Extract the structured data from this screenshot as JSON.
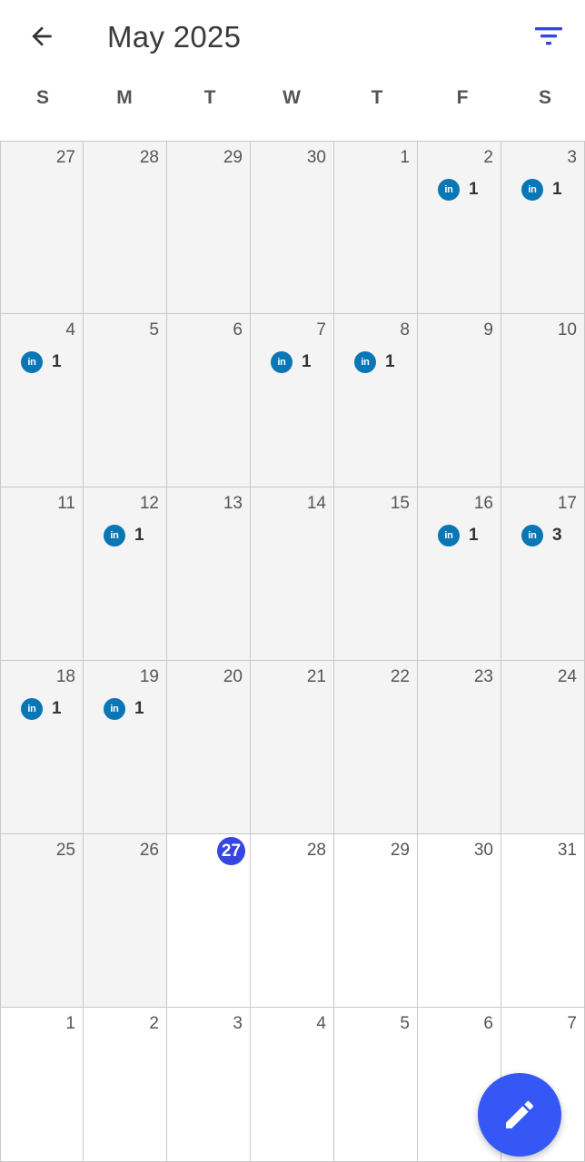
{
  "header": {
    "title": "May 2025",
    "back_icon": "arrow-left-icon",
    "filter_icon": "filter-icon"
  },
  "colors": {
    "accent": "#3547e0",
    "linkedin": "#0a76b4",
    "fab": "#3557f6",
    "past_cell": "#f4f4f4",
    "future_cell": "#ffffff"
  },
  "weekdays": [
    "S",
    "M",
    "T",
    "W",
    "T",
    "F",
    "S"
  ],
  "today": "27",
  "weeks": [
    [
      {
        "day": "27",
        "current": false,
        "events": []
      },
      {
        "day": "28",
        "current": false,
        "events": []
      },
      {
        "day": "29",
        "current": false,
        "events": []
      },
      {
        "day": "30",
        "current": false,
        "events": []
      },
      {
        "day": "1",
        "current": false,
        "events": []
      },
      {
        "day": "2",
        "current": false,
        "events": [
          {
            "icon": "linkedin-icon",
            "label": "in",
            "count": "1"
          }
        ]
      },
      {
        "day": "3",
        "current": false,
        "events": [
          {
            "icon": "linkedin-icon",
            "label": "in",
            "count": "1"
          }
        ]
      }
    ],
    [
      {
        "day": "4",
        "current": false,
        "events": [
          {
            "icon": "linkedin-icon",
            "label": "in",
            "count": "1"
          }
        ]
      },
      {
        "day": "5",
        "current": false,
        "events": []
      },
      {
        "day": "6",
        "current": false,
        "events": []
      },
      {
        "day": "7",
        "current": false,
        "events": [
          {
            "icon": "linkedin-icon",
            "label": "in",
            "count": "1"
          }
        ]
      },
      {
        "day": "8",
        "current": false,
        "events": [
          {
            "icon": "linkedin-icon",
            "label": "in",
            "count": "1"
          }
        ]
      },
      {
        "day": "9",
        "current": false,
        "events": []
      },
      {
        "day": "10",
        "current": false,
        "events": []
      }
    ],
    [
      {
        "day": "11",
        "current": false,
        "events": []
      },
      {
        "day": "12",
        "current": false,
        "events": [
          {
            "icon": "linkedin-icon",
            "label": "in",
            "count": "1"
          }
        ]
      },
      {
        "day": "13",
        "current": false,
        "events": []
      },
      {
        "day": "14",
        "current": false,
        "events": []
      },
      {
        "day": "15",
        "current": false,
        "events": []
      },
      {
        "day": "16",
        "current": false,
        "events": [
          {
            "icon": "linkedin-icon",
            "label": "in",
            "count": "1"
          }
        ]
      },
      {
        "day": "17",
        "current": false,
        "events": [
          {
            "icon": "linkedin-icon",
            "label": "in",
            "count": "3"
          }
        ]
      }
    ],
    [
      {
        "day": "18",
        "current": false,
        "events": [
          {
            "icon": "linkedin-icon",
            "label": "in",
            "count": "1"
          }
        ]
      },
      {
        "day": "19",
        "current": false,
        "events": [
          {
            "icon": "linkedin-icon",
            "label": "in",
            "count": "1"
          }
        ]
      },
      {
        "day": "20",
        "current": false,
        "events": []
      },
      {
        "day": "21",
        "current": false,
        "events": []
      },
      {
        "day": "22",
        "current": false,
        "events": []
      },
      {
        "day": "23",
        "current": false,
        "events": []
      },
      {
        "day": "24",
        "current": false,
        "events": []
      }
    ],
    [
      {
        "day": "25",
        "current": false,
        "events": []
      },
      {
        "day": "26",
        "current": false,
        "events": []
      },
      {
        "day": "27",
        "current": true,
        "today": true,
        "events": []
      },
      {
        "day": "28",
        "current": true,
        "events": []
      },
      {
        "day": "29",
        "current": true,
        "events": []
      },
      {
        "day": "30",
        "current": true,
        "events": []
      },
      {
        "day": "31",
        "current": true,
        "events": []
      }
    ],
    [
      {
        "day": "1",
        "current": true,
        "events": []
      },
      {
        "day": "2",
        "current": true,
        "events": []
      },
      {
        "day": "3",
        "current": true,
        "events": []
      },
      {
        "day": "4",
        "current": true,
        "events": []
      },
      {
        "day": "5",
        "current": true,
        "events": []
      },
      {
        "day": "6",
        "current": true,
        "events": []
      },
      {
        "day": "7",
        "current": true,
        "events": []
      }
    ]
  ],
  "fab": {
    "icon": "pencil-icon"
  }
}
